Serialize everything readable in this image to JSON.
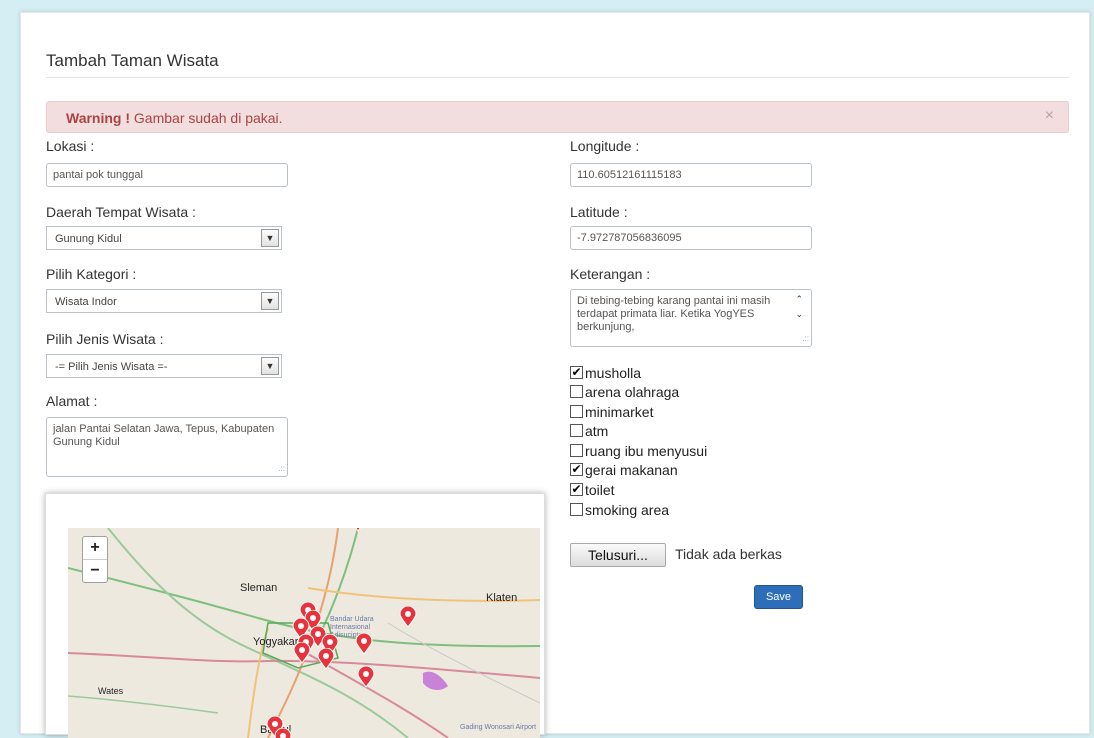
{
  "form": {
    "title": "Tambah Taman Wisata",
    "alert": {
      "strong": "Warning !",
      "message": " Gambar sudah di pakai.",
      "close": "×"
    },
    "lokasi": {
      "label": "Lokasi :",
      "value": "pantai pok tunggal"
    },
    "daerah": {
      "label": "Daerah Tempat Wisata :",
      "value": "Gunung Kidul"
    },
    "kategori": {
      "label": "Pilih Kategori :",
      "value": "Wisata Indor"
    },
    "jenis": {
      "label": "Pilih Jenis Wisata :",
      "value": "-= Pilih Jenis Wisata =-"
    },
    "alamat": {
      "label": "Alamat :",
      "value": "jalan Pantai Selatan Jawa, Tepus, Kabupaten Gunung Kidul"
    },
    "longitude": {
      "label": "Longitude :",
      "value": "110.60512161115183"
    },
    "latitude": {
      "label": "Latitude :",
      "value": "-7.972787056836095"
    },
    "keterangan": {
      "label": "Keterangan :",
      "value": "Di tebing-tebing karang pantai ini masih terdapat primata liar. Ketika YogYES berkunjung,"
    },
    "facilities": [
      {
        "label": "musholla",
        "checked": true
      },
      {
        "label": "arena olahraga",
        "checked": false
      },
      {
        "label": "minimarket",
        "checked": false
      },
      {
        "label": "atm",
        "checked": false
      },
      {
        "label": "ruang ibu menyusui",
        "checked": false
      },
      {
        "label": "gerai makanan",
        "checked": true
      },
      {
        "label": "toilet",
        "checked": true
      },
      {
        "label": "smoking area",
        "checked": false
      }
    ],
    "file": {
      "button": "Telusuri...",
      "status": "Tidak ada berkas"
    },
    "save": "Save"
  },
  "map": {
    "zoom_in": "+",
    "zoom_out": "−",
    "labels": [
      "Sleman",
      "Klaten",
      "Yogyakarta",
      "Wates",
      "Bantul",
      "Bandar Udara Internasional Adisucipto",
      "Gading Wonosari Airport"
    ]
  },
  "colors": {
    "accent": "#2e6eb8",
    "alert_bg": "#f2dede",
    "alert_text": "#a94442",
    "marker": "#e8323c"
  }
}
